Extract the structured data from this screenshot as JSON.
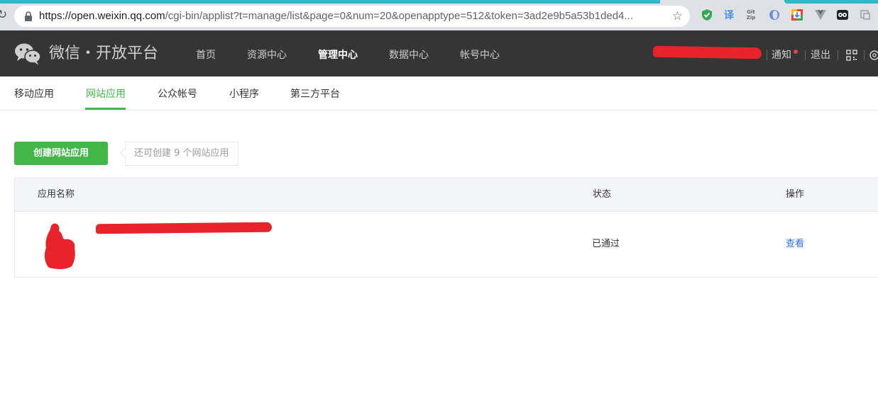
{
  "browser": {
    "url_host": "https://open.weixin.qq.com",
    "url_rest": "/cgi-bin/applist?t=manage/list&page=0&num=20&openapptype=512&token=3ad2e9b5a53b1ded4...",
    "extensions": [
      "shield-check-icon",
      "translate-icon",
      "gitzip-icon",
      "reader-icon",
      "download-icon",
      "vue-icon",
      "owl-icon",
      "capture-icon"
    ],
    "ext_glyphs": {
      "translate": "译",
      "gitzip": "Git\nZip"
    }
  },
  "header": {
    "logo_text": "微信・开放平台",
    "nav": [
      {
        "label": "首页",
        "active": false
      },
      {
        "label": "资源中心",
        "active": false
      },
      {
        "label": "管理中心",
        "active": true
      },
      {
        "label": "数据中心",
        "active": false
      },
      {
        "label": "帐号中心",
        "active": false
      }
    ],
    "notice": "通知",
    "logout": "退出"
  },
  "subnav": {
    "tabs": [
      {
        "label": "移动应用",
        "active": false
      },
      {
        "label": "网站应用",
        "active": true
      },
      {
        "label": "公众帐号",
        "active": false
      },
      {
        "label": "小程序",
        "active": false
      },
      {
        "label": "第三方平台",
        "active": false
      }
    ]
  },
  "main": {
    "create_button": "创建网站应用",
    "tip": "还可创建 9 个网站应用",
    "table": {
      "columns": [
        "应用名称",
        "状态",
        "操作"
      ],
      "rows": [
        {
          "status": "已通过",
          "action": "查看"
        }
      ]
    }
  },
  "colors": {
    "brand_green": "#44b549",
    "header_bg": "#353535",
    "link_blue": "#2a6fd6",
    "redaction_red": "#e8232a"
  }
}
